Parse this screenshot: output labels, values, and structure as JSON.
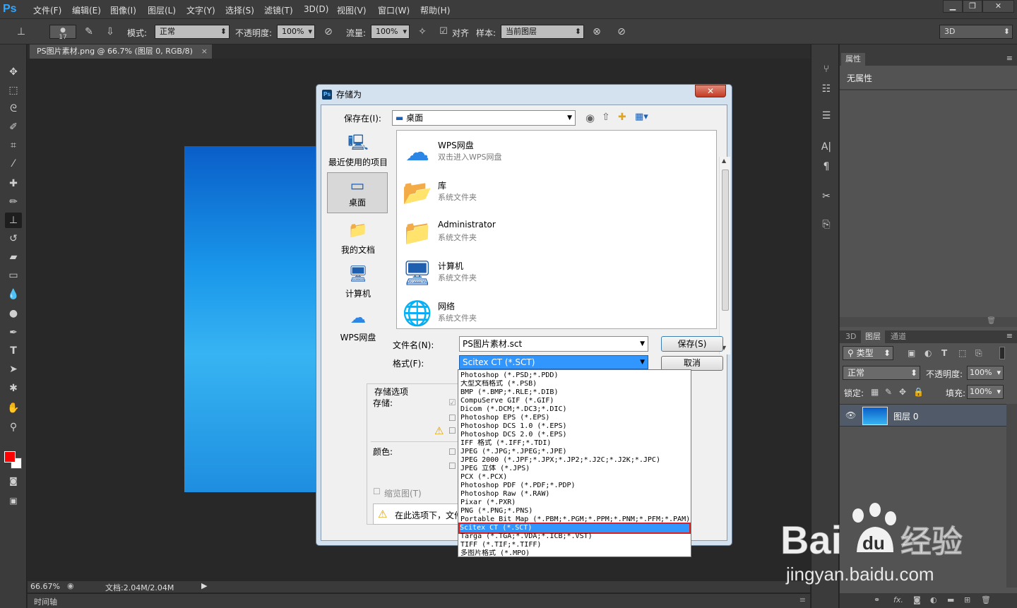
{
  "app": {
    "logo": "Ps",
    "menu": [
      "文件(F)",
      "编辑(E)",
      "图像(I)",
      "图层(L)",
      "文字(Y)",
      "选择(S)",
      "滤镜(T)",
      "3D(D)",
      "视图(V)",
      "窗口(W)",
      "帮助(H)"
    ]
  },
  "options": {
    "brush_size": "17",
    "mode_label": "模式:",
    "mode_value": "正常",
    "opacity_label": "不透明度:",
    "opacity_value": "100%",
    "flow_label": "流量:",
    "flow_value": "100%",
    "align_label": "对齐",
    "sample_label": "样本:",
    "sample_value": "当前图层",
    "workspace": "3D"
  },
  "document": {
    "tab": "PS图片素材.png @ 66.7% (图层 0, RGB/8)",
    "zoom": "66.67%",
    "docsize": "文档:2.04M/2.04M",
    "timeline": "时间轴"
  },
  "properties": {
    "tab": "属性",
    "empty": "无属性"
  },
  "layers": {
    "tabs": [
      "3D",
      "图层",
      "通道"
    ],
    "filter": "类型",
    "blend": "正常",
    "opacity_label": "不透明度:",
    "opacity_value": "100%",
    "lock_label": "锁定:",
    "fill_label": "填充:",
    "fill_value": "100%",
    "layer_name": "图层 0"
  },
  "dialog": {
    "title": "存储为",
    "save_in_label": "保存在(I):",
    "save_in_value": "桌面",
    "places": [
      "最近使用的项目",
      "桌面",
      "我的文档",
      "计算机",
      "WPS网盘"
    ],
    "files": [
      {
        "name": "WPS网盘",
        "sub": "双击进入WPS网盘"
      },
      {
        "name": "库",
        "sub": "系统文件夹"
      },
      {
        "name": "Administrator",
        "sub": "系统文件夹"
      },
      {
        "name": "计算机",
        "sub": "系统文件夹"
      },
      {
        "name": "网络",
        "sub": "系统文件夹"
      }
    ],
    "filename_label": "文件名(N):",
    "filename_value": "PS图片素材.sct",
    "format_label": "格式(F):",
    "format_value": "Scitex CT (*.SCT)",
    "save_button": "保存(S)",
    "cancel_button": "取消",
    "save_options_label": "存储选项",
    "storage_label": "存储:",
    "color_label": "颜色:",
    "thumbnail_label": "缩览图(T)",
    "warning_text": "在此选项下，文件"
  },
  "format_options": [
    "Photoshop (*.PSD;*.PDD)",
    "大型文档格式 (*.PSB)",
    "BMP (*.BMP;*.RLE;*.DIB)",
    "CompuServe GIF (*.GIF)",
    "Dicom (*.DCM;*.DC3;*.DIC)",
    "Photoshop EPS (*.EPS)",
    "Photoshop DCS 1.0 (*.EPS)",
    "Photoshop DCS 2.0 (*.EPS)",
    "IFF 格式 (*.IFF;*.TDI)",
    "JPEG (*.JPG;*.JPEG;*.JPE)",
    "JPEG 2000 (*.JPF;*.JPX;*.JP2;*.J2C;*.J2K;*.JPC)",
    "JPEG 立体 (*.JPS)",
    "PCX (*.PCX)",
    "Photoshop PDF (*.PDF;*.PDP)",
    "Photoshop Raw (*.RAW)",
    "Pixar (*.PXR)",
    "PNG (*.PNG;*.PNS)",
    "Portable Bit Map (*.PBM;*.PGM;*.PPM;*.PNM;*.PFM;*.PAM)",
    "Scitex CT (*.SCT)",
    "Targa (*.TGA;*.VDA;*.ICB;*.VST)",
    "TIFF (*.TIF;*.TIFF)",
    "多图片格式 (*.MPO)"
  ],
  "selected_format_index": 18,
  "watermark": {
    "brand": "Bai",
    "brand2": "du",
    "cn": "经验",
    "url": "jingyan.baidu.com"
  },
  "colors": {
    "foreground": "#ff0000",
    "background": "#ffffff",
    "selection": "#3296ff",
    "highlight_border": "#e02020"
  }
}
